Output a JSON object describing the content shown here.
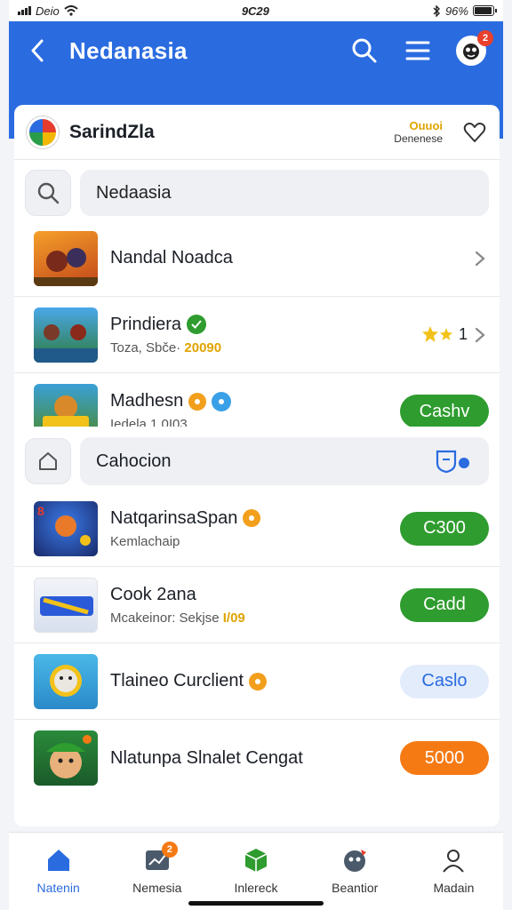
{
  "status_bar": {
    "carrier": "Deio",
    "time": "9C29",
    "battery": "96%",
    "battery_level": 0.96
  },
  "header": {
    "title": "Nedanasia",
    "notification_count": "2"
  },
  "app_card": {
    "name": "SarindZla",
    "points_label": "Ouuoi",
    "points_sub": "Denenese",
    "search_value": "Nedaasia",
    "items": [
      {
        "title": "Nandal Noadca",
        "subtitle": "",
        "action": "chevron"
      },
      {
        "title": "Prindiera",
        "subtitle_prefix": "Toza, Sbče·",
        "subtitle_value": "20090",
        "rating": "1",
        "action": "chevron"
      },
      {
        "title": "Madhesn",
        "subtitle": "Iedela 1 0I03",
        "action_label": "Cashv"
      }
    ]
  },
  "category_card": {
    "field_label": "Cahocion",
    "items": [
      {
        "title": "NatqarinsaSpan",
        "subtitle": "Kemlachaip",
        "action_label": "C300",
        "style": "green"
      },
      {
        "title": "Cook 2ana",
        "subtitle_prefix": "Mcakeinor: Sekjse",
        "subtitle_value": "I/09",
        "action_label": "Cadd",
        "style": "green"
      },
      {
        "title": "Tlaineo Curclient",
        "subtitle": "",
        "action_label": "Caslo",
        "style": "blue"
      },
      {
        "title": "Nlatunpa Slnalet Cengat",
        "subtitle": "",
        "action_label": "5000",
        "style": "orange"
      }
    ]
  },
  "bottom_nav": [
    {
      "label": "Natenin",
      "icon": "home-icon",
      "active": true
    },
    {
      "label": "Nemesia",
      "icon": "chart-icon",
      "badge": "2"
    },
    {
      "label": "Inlereck",
      "icon": "cube-icon"
    },
    {
      "label": "Beantior",
      "icon": "game-icon"
    },
    {
      "label": "Madain",
      "icon": "person-icon"
    }
  ],
  "colors": {
    "primary": "#2a6be0",
    "green": "#2e9c2e",
    "orange": "#f57a14",
    "gold": "#e0a400"
  }
}
